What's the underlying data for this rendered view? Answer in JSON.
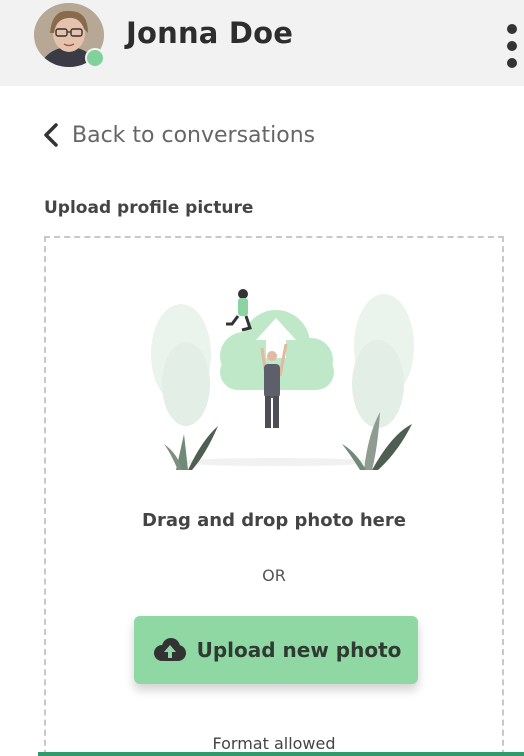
{
  "header": {
    "user_name": "Jonna Doe",
    "status": "online",
    "status_color": "#7fd39a",
    "menu_icon": "more-vertical-icon"
  },
  "navigation": {
    "back_label": "Back to conversations",
    "back_icon": "chevron-left-icon"
  },
  "upload": {
    "section_title": "Upload profile picture",
    "drag_text": "Drag and drop photo here",
    "or_text": "OR",
    "button_label": "Upload new photo",
    "button_icon": "cloud-upload-icon",
    "button_color": "#8fd8a4",
    "format_text": "Format allowed"
  },
  "accent_color": "#2f9a6b"
}
